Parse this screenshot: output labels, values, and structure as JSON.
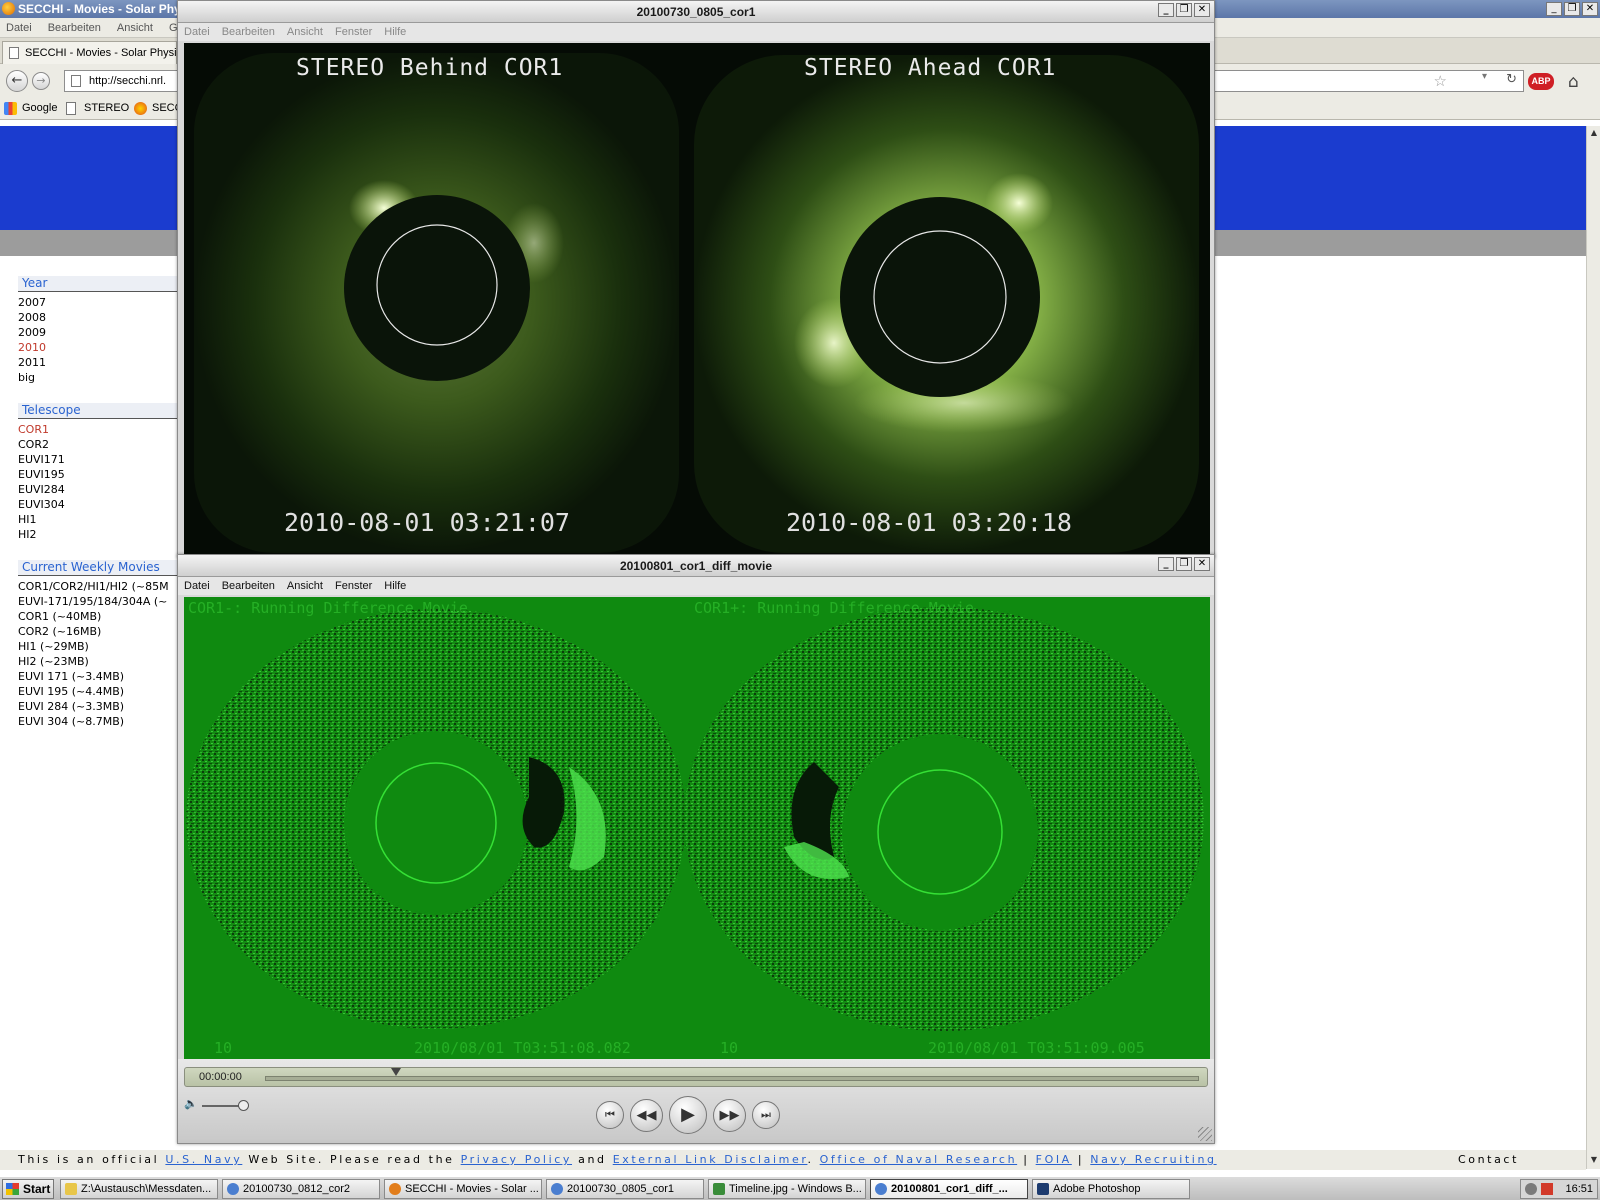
{
  "firefox": {
    "title": "SECCHI - Movies - Solar Phy",
    "menu": [
      "Datei",
      "Bearbeiten",
      "Ansicht",
      "G"
    ],
    "tab_title": "SECCHI - Movies - Solar Physics",
    "url": "http://secchi.nrl.",
    "bookmarks": [
      "Google",
      "STEREO",
      "SECC"
    ],
    "abp_label": "ABP"
  },
  "sidebar": {
    "year": {
      "heading": "Year",
      "items": [
        "2007",
        "2008",
        "2009",
        "2010",
        "2011",
        "big"
      ],
      "selected": "2010"
    },
    "telescope": {
      "heading": "Telescope",
      "items": [
        "COR1",
        "COR2",
        "EUVI171",
        "EUVI195",
        "EUVI284",
        "EUVI304",
        "HI1",
        "HI2"
      ],
      "selected": "COR1"
    },
    "movies": {
      "heading": "Current Weekly Movies",
      "items": [
        "COR1/COR2/HI1/HI2 (~85M",
        "EUVI-171/195/184/304A (~",
        "COR1 (~40MB)",
        "COR2 (~16MB)",
        "HI1 (~29MB)",
        "HI2 (~23MB)",
        "EUVI 171 (~3.4MB)",
        "EUVI 195 (~4.4MB)",
        "EUVI 284 (~3.3MB)",
        "EUVI 304 (~8.7MB)"
      ]
    }
  },
  "footer": {
    "lead": "This is an official ",
    "navy": "U.S. Navy",
    "mid1": " Web Site. Please read the ",
    "privacy": "Privacy Policy",
    "mid2": " and ",
    "disclaimer": "External Link Disclaimer",
    "dot": ". ",
    "onr": "Office of Naval Research",
    "sep1": " | ",
    "foia": "FOIA",
    "sep2": " | ",
    "recruiting": "Navy Recruiting",
    "contact": "Contact"
  },
  "qt_top": {
    "title": "20100730_0805_cor1",
    "menu": [
      "Datei",
      "Bearbeiten",
      "Ansicht",
      "Fenster",
      "Hilfe"
    ],
    "left_label": "STEREO Behind COR1",
    "right_label": "STEREO Ahead COR1",
    "left_time": "2010-08-01 03:21:07",
    "right_time": "2010-08-01 03:20:18"
  },
  "qt_bottom": {
    "title": "20100801_cor1_diff_movie",
    "menu": [
      "Datei",
      "Bearbeiten",
      "Ansicht",
      "Fenster",
      "Hilfe"
    ],
    "left_label": "COR1-: Running Difference Movie",
    "right_label": "COR1+: Running Difference Movie",
    "left_foot_num": "10",
    "right_foot_num": "10",
    "left_foot_time": "2010/08/01 T03:51:08.082",
    "right_foot_time": "2010/08/01 T03:51:09.005",
    "timecode": "00:00:00",
    "progress_fraction": 0.14
  },
  "taskbar": {
    "start": "Start",
    "tasks": [
      "Z:\\Austausch\\Messdaten...",
      "20100730_0812_cor2",
      "SECCHI - Movies - Solar ...",
      "20100730_0805_cor1",
      "Timeline.jpg - Windows B...",
      "20100801_cor1_diff_...",
      "Adobe Photoshop"
    ],
    "active_task": "20100801_cor1_diff_...",
    "clock": "16:51"
  },
  "colors": {
    "banner": "#1b3ccf",
    "link": "#2a63d0",
    "selected": "#c0392b",
    "diff_green": "#0f8a10"
  },
  "icons": [
    "firefox-icon",
    "back-icon",
    "forward-icon",
    "reload-icon",
    "home-icon",
    "bookmark-star-icon",
    "speaker-icon",
    "play-icon",
    "rewind-icon",
    "fast-forward-icon",
    "skip-start-icon",
    "skip-end-icon"
  ]
}
